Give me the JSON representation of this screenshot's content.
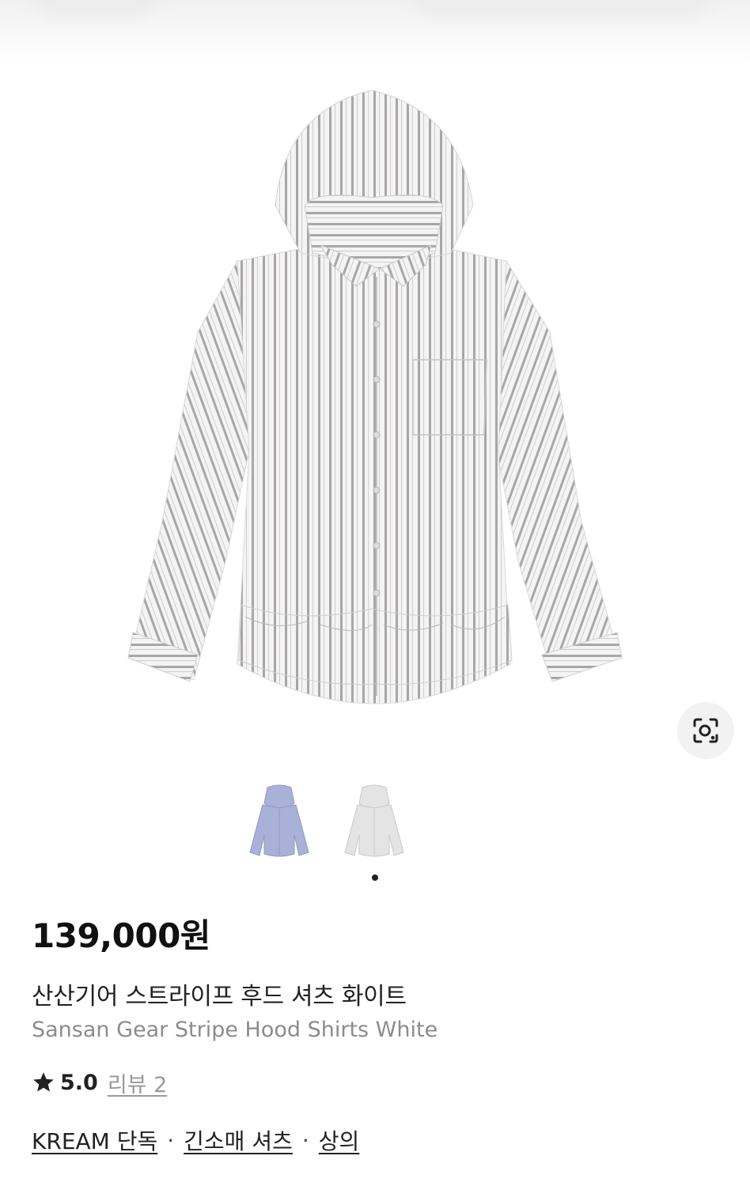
{
  "product": {
    "price": "139,000원",
    "name_ko": "산산기어 스트라이프 후드 셔츠 화이트",
    "name_en": "Sansan Gear Stripe Hood Shirts White",
    "rating": "5.0",
    "review_label": "리뷰 2"
  },
  "gallery": {
    "active_index": 1,
    "thumbnails": [
      {
        "icon": "shirt-thumbnail-blue",
        "color": "#a9b1d8"
      },
      {
        "icon": "shirt-thumbnail-white",
        "color": "#e4e4e4"
      }
    ]
  },
  "tags": [
    {
      "label": "KREAM 단독"
    },
    {
      "label": "긴소매 셔츠"
    },
    {
      "label": "상의"
    }
  ],
  "tag_separator": "·",
  "icons": {
    "lens": "lens-search-icon",
    "star": "star-icon"
  },
  "colors": {
    "stripe": "#a9a6a8",
    "shirt_base": "#f4f4f4",
    "text_primary": "#222222",
    "text_secondary": "#8c8c8c"
  }
}
